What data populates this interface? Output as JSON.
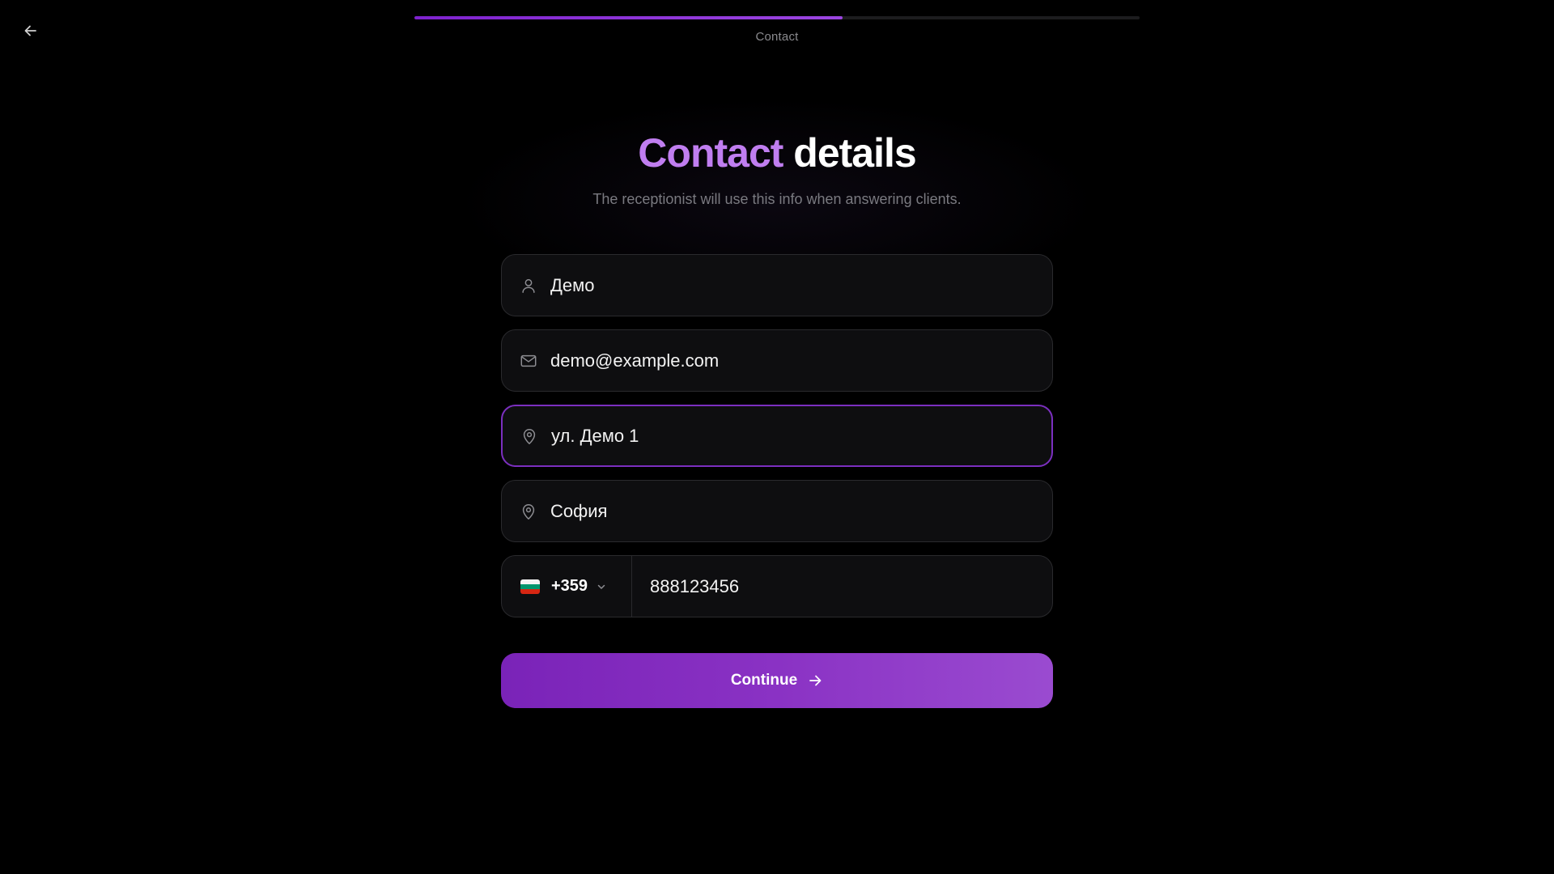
{
  "header": {
    "back_icon": "arrow-left-icon",
    "step_label": "Contact",
    "progress": 0.59,
    "progress_color": "#7e22ce"
  },
  "title": {
    "accent": "Contact",
    "rest": " details",
    "accent_color": "#c07ef0"
  },
  "subtitle": "The receptionist will use this info when answering clients.",
  "form": {
    "name": {
      "icon": "user-icon",
      "value": "Демо"
    },
    "email": {
      "icon": "mail-icon",
      "value": "demo@example.com"
    },
    "address": {
      "icon": "map-pin-icon",
      "value": "ул. Демо 1",
      "focused": true
    },
    "city": {
      "icon": "map-pin-icon",
      "value": "София"
    },
    "phone": {
      "country_flag": "bulgaria-flag-icon",
      "dial_code": "+359",
      "number": "888123456"
    }
  },
  "continue_button": {
    "label": "Continue",
    "icon": "arrow-right-icon",
    "color": "#8a32c4"
  }
}
